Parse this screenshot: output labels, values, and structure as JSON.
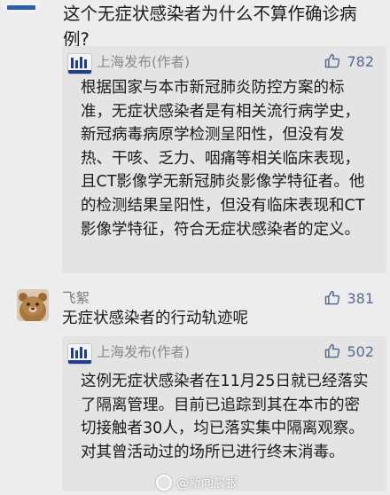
{
  "question": {
    "text": "这个无症状感染者为什么不算作确诊病例?"
  },
  "reply1": {
    "author": "上海发布(作者)",
    "likes": "782",
    "text": "根据国家与本市新冠肺炎防控方案的标准，无症状感染者是有相关流行病学史，新冠病毒病原学检测呈阳性，但没有发热、干咳、乏力、咽痛等相关临床表现，且CT影像学无新冠肺炎影像学特征者。他的检测结果呈阳性，但没有临床表现和CT影像学特征，符合无症状感染者的定义。"
  },
  "comment": {
    "author": "飞絮",
    "likes": "381",
    "text": "无症状感染者的行动轨迹呢"
  },
  "reply2": {
    "author": "上海发布(作者)",
    "likes": "502",
    "text": "这例无症状感染者在11月25日就已经落实了隔离管理。目前已追踪到其在本市的密切接触者30人，均已落实集中隔离观察。对其曾活动过的场所已进行终末消毒。"
  },
  "watermark": {
    "text": "@新闻晨报"
  },
  "colors": {
    "like_blue": "#576b95",
    "background": "#ededed",
    "reply_bg": "#e4e4e4"
  },
  "icons": {
    "like": "thumbs-up-icon"
  }
}
